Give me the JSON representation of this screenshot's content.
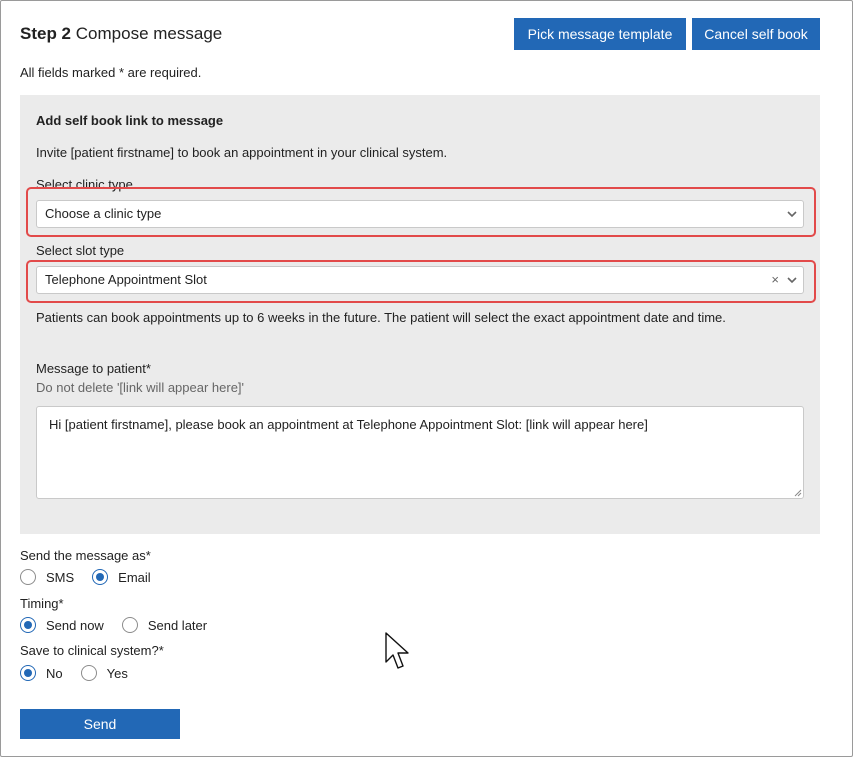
{
  "header": {
    "step": "Step 2",
    "title": "Compose message"
  },
  "actions": {
    "pick_template": "Pick message template",
    "cancel_self_book": "Cancel self book"
  },
  "required_note": "All fields marked * are required.",
  "panel": {
    "title": "Add self book link to message",
    "description": "Invite [patient firstname] to book an appointment in your clinical system.",
    "clinic_type": {
      "label": "Select clinic type",
      "value": "Choose a clinic type"
    },
    "slot_type": {
      "label": "Select slot type",
      "value": "Telephone Appointment Slot",
      "clear": "×"
    },
    "info": "Patients can book appointments up to 6 weeks in the future. The patient will select the exact appointment date and time.",
    "message": {
      "label": "Message to patient*",
      "hint": "Do not delete '[link will appear here]'",
      "value": "Hi [patient firstname], please book an appointment at Telephone Appointment Slot: [link will appear here]"
    }
  },
  "send_as": {
    "label": "Send the message as*",
    "options": [
      "SMS",
      "Email"
    ],
    "selected": "Email"
  },
  "timing": {
    "label": "Timing*",
    "options": [
      "Send now",
      "Send later"
    ],
    "selected": "Send now"
  },
  "save_clinical": {
    "label": "Save to clinical system?*",
    "options": [
      "No",
      "Yes"
    ],
    "selected": "No"
  },
  "send_button": "Send",
  "colors": {
    "primary": "#2268b6",
    "highlight": "#e24a4a",
    "panel": "#ebebeb"
  },
  "icons": {
    "dropdown": "chevron-down-icon",
    "pointer": "mouse-cursor-icon"
  }
}
